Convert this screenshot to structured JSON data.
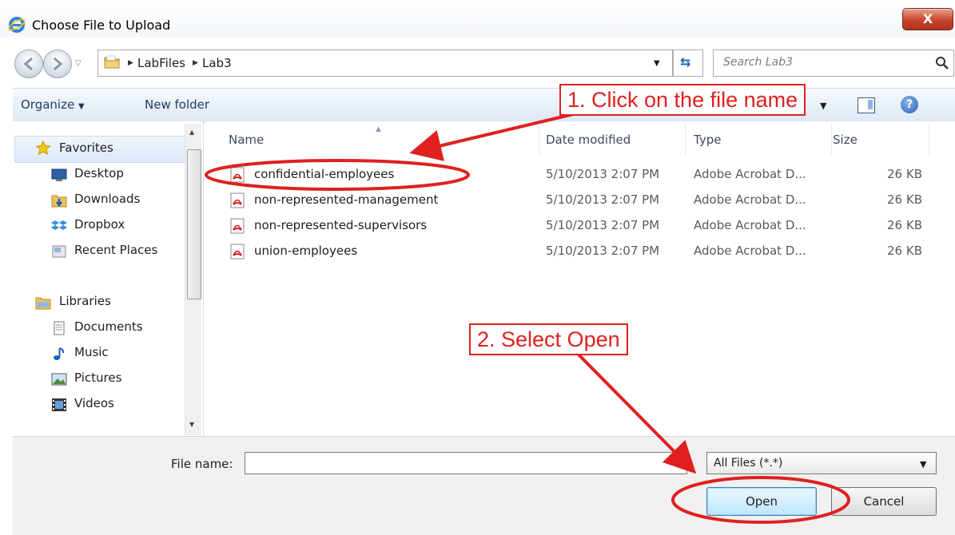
{
  "window": {
    "title": "Choose File to Upload",
    "close_label": "X"
  },
  "address": {
    "breadcrumbs": [
      "LabFiles",
      "Lab3"
    ],
    "search_placeholder": "Search Lab3"
  },
  "toolbar": {
    "organize_label": "Organize",
    "new_folder_label": "New folder"
  },
  "nav": {
    "favorites_label": "Favorites",
    "favorites": [
      "Desktop",
      "Downloads",
      "Dropbox",
      "Recent Places"
    ],
    "libraries_label": "Libraries",
    "libraries": [
      "Documents",
      "Music",
      "Pictures",
      "Videos"
    ]
  },
  "files": {
    "columns": [
      "Name",
      "Date modified",
      "Type",
      "Size"
    ],
    "rows": [
      {
        "name": "confidential-employees",
        "date": "5/10/2013 2:07 PM",
        "type": "Adobe Acrobat D...",
        "size": "26 KB"
      },
      {
        "name": "non-represented-management",
        "date": "5/10/2013 2:07 PM",
        "type": "Adobe Acrobat D...",
        "size": "26 KB"
      },
      {
        "name": "non-represented-supervisors",
        "date": "5/10/2013 2:07 PM",
        "type": "Adobe Acrobat D...",
        "size": "26 KB"
      },
      {
        "name": "union-employees",
        "date": "5/10/2013 2:07 PM",
        "type": "Adobe Acrobat D...",
        "size": "26 KB"
      }
    ]
  },
  "bottom": {
    "file_name_label": "File name:",
    "file_name_value": "",
    "filter_value": "All Files (*.*)",
    "open_label": "Open",
    "cancel_label": "Cancel"
  },
  "annotations": {
    "step1": "1. Click on the file name",
    "step2": "2. Select Open",
    "color": "#e02020"
  }
}
